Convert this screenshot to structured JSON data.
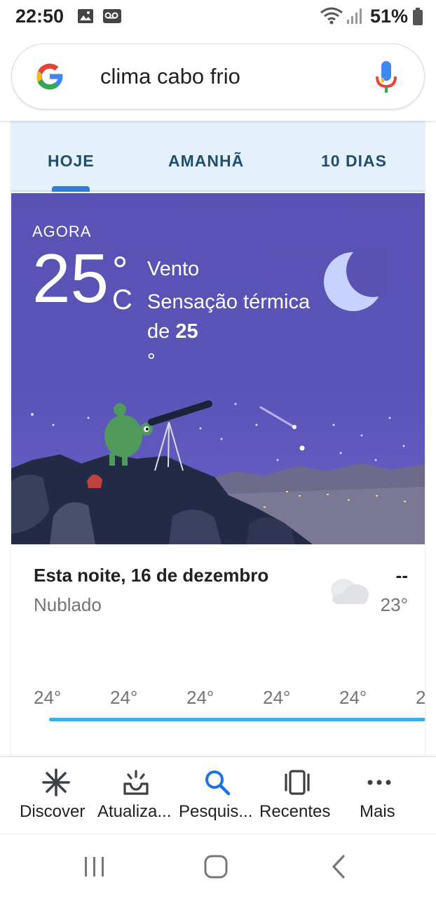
{
  "status_bar": {
    "time": "22:50",
    "battery": "51%",
    "icons": [
      "gallery-icon",
      "voicemail-icon",
      "wifi-icon",
      "signal-icon",
      "battery-icon"
    ]
  },
  "search": {
    "query": "clima cabo frio",
    "icons": [
      "google-logo-icon",
      "mic-icon"
    ]
  },
  "weather": {
    "tabs": [
      "HOJE",
      "AMANHÃ",
      "10 DIAS"
    ],
    "active_tab": "HOJE",
    "now_label": "AGORA",
    "temperature": "25",
    "degree": "°",
    "unit": "C",
    "wind_label": "Vento",
    "feels_like_prefix": "Sensação térmica de",
    "feels_like_value": "25",
    "feels_like_deg": "°",
    "scene_icon": "moon-icon",
    "tonight_title": "Esta noite, 16 de dezembro",
    "condition": "Nublado",
    "condition_icon": "cloud-icon",
    "high": "--",
    "low": "23°",
    "hourly": [
      "24°",
      "24°",
      "24°",
      "24°",
      "24°",
      "2"
    ],
    "accent_color": "#3aaee9",
    "scene_color": "#5a52b3"
  },
  "bottom_nav": {
    "items": [
      {
        "label": "Discover",
        "icon": "discover-asterisk-icon"
      },
      {
        "label": "Atualiza...",
        "icon": "updates-tray-icon"
      },
      {
        "label": "Pesquis...",
        "icon": "search-icon"
      },
      {
        "label": "Recentes",
        "icon": "recents-icon"
      },
      {
        "label": "Mais",
        "icon": "more-dots-icon"
      }
    ],
    "active": "Pesquis..."
  },
  "system_nav": {
    "icons": [
      "recent-apps-icon",
      "home-icon",
      "back-icon"
    ]
  }
}
